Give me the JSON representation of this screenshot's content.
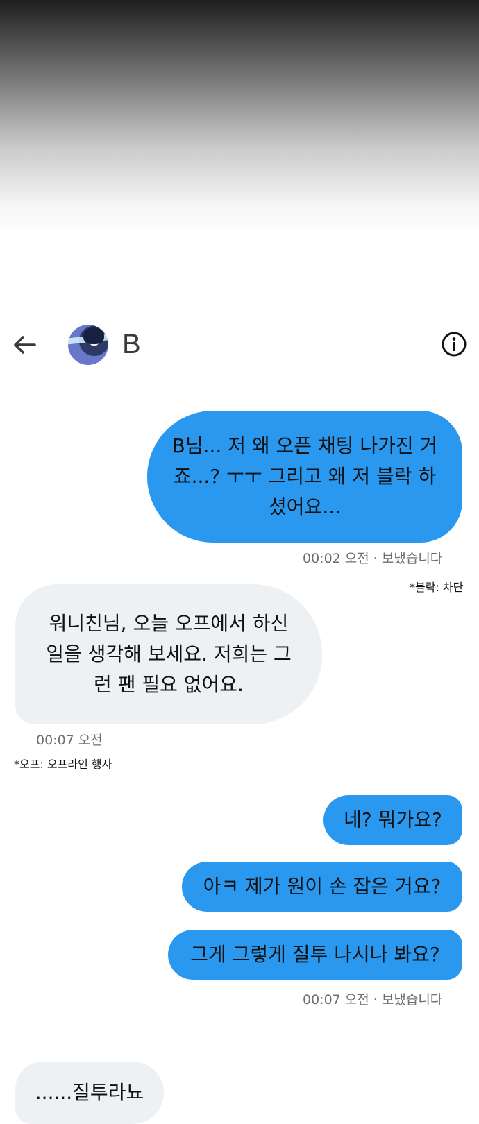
{
  "header": {
    "contact_name": "B",
    "back_icon": "arrow-left-icon",
    "info_icon": "info-circle-icon"
  },
  "messages": [
    {
      "direction": "outgoing",
      "text": "B님... 저 왜 오픈 채팅 나가진 거죠...? ㅜㅜ 그리고 왜 저 블락 하셨어요..."
    },
    {
      "direction": "incoming",
      "text": "워니친님, 오늘 오프에서 하신 일을 생각해 보세요. 저희는 그런 팬 필요 없어요."
    },
    {
      "direction": "outgoing",
      "text": "네? 뭐가요?"
    },
    {
      "direction": "outgoing",
      "text": "아ㅋ 제가 원이 손 잡은 거요?"
    },
    {
      "direction": "outgoing",
      "text": "그게 그렇게 질투 나시나 봐요?"
    },
    {
      "direction": "incoming",
      "text": "......질투라뇨"
    }
  ],
  "timestamps": {
    "t1": "00:02 오전 · 보냈습니다",
    "t2": "00:07 오전",
    "t3": "00:07 오전 · 보냈습니다"
  },
  "notes": {
    "block": "*블락: 차단",
    "off": "*오프: 오프라인 행사"
  },
  "colors": {
    "outgoing_bubble": "#2a98ee",
    "incoming_bubble": "#eef1f3",
    "timestamp_text": "#6b6f73"
  }
}
